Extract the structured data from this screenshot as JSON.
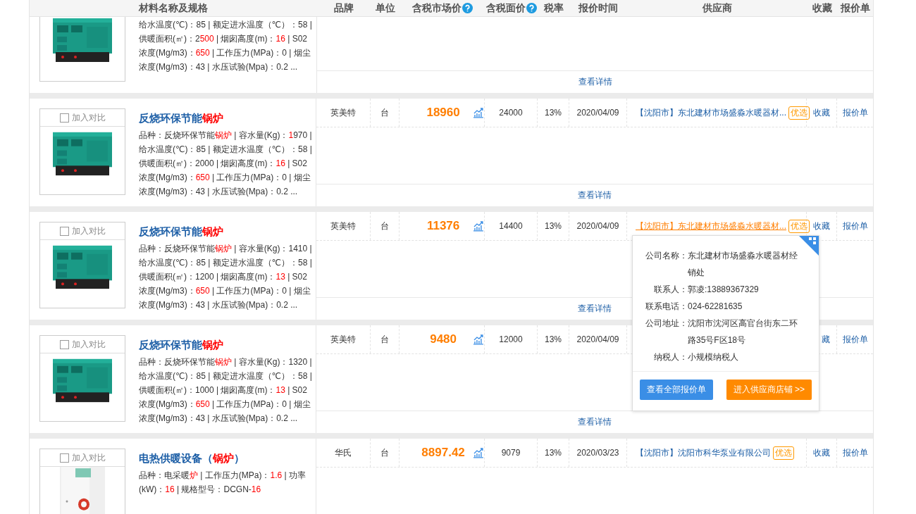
{
  "header": {
    "columns": [
      {
        "label": "材料名称及规格"
      },
      {
        "label": "品牌"
      },
      {
        "label": "单位"
      },
      {
        "label": "含税市场价",
        "help": true
      },
      {
        "label": "含税面价",
        "help": true
      },
      {
        "label": "税率"
      },
      {
        "label": "报价时间"
      },
      {
        "label": "供应商"
      },
      {
        "label": "收藏"
      },
      {
        "label": "报价单"
      }
    ]
  },
  "rows": [
    {
      "spec": [
        {
          "text": "给水温度(℃)：85 | 额定进水温度（℃）：58 | 供暖面积(㎡)：2",
          "highlight": false
        },
        {
          "text": "500",
          "highlight": true
        },
        {
          "text": " | 烟囱高度(m)：",
          "highlight": false
        },
        {
          "text": "16",
          "highlight": true
        },
        {
          "text": " | S02浓度(Mg/m3)：",
          "highlight": false
        },
        {
          "text": "650",
          "highlight": true
        },
        {
          "text": " | 工作压力(MPa)：0 | 烟尘浓度(Mg/m3)：43 | 水压试验(Mpa)：0.2 ...",
          "highlight": false
        }
      ],
      "details": "查看详情"
    },
    {
      "compare": {
        "label": "加入对比",
        "checked": false
      },
      "title": [
        {
          "text": "反烧环保节能",
          "highlight": false
        },
        {
          "text": "锅炉",
          "highlight": true
        }
      ],
      "spec": [
        {
          "text": "品种：反烧环保节能",
          "highlight": false
        },
        {
          "text": "锅炉",
          "highlight": true
        },
        {
          "text": " | 容水量(Kg)：",
          "highlight": false
        },
        {
          "text": "1",
          "highlight": true
        },
        {
          "text": "970 | 给水温度(℃)：85 | 额定进水温度（℃）：58 | 供暖面积(㎡)：2000 | 烟囱高度(m)：",
          "highlight": false
        },
        {
          "text": "16",
          "highlight": true
        },
        {
          "text": " | S02浓度(Mg/m3)：",
          "highlight": false
        },
        {
          "text": "650",
          "highlight": true
        },
        {
          "text": " | 工作压力(MPa)：0 | 烟尘浓度(Mg/m3)：43 | 水压试验(Mpa)：0.2 ...",
          "highlight": false
        }
      ],
      "cells": {
        "brand": "英美特",
        "unit": "台",
        "price": "18960",
        "face_price": "24000",
        "tax": "13%",
        "date": "2020/04/09",
        "supplier": {
          "text": "【沈阳市】东北建材市场盛淼水暖器材...",
          "hovered": false
        },
        "badge": "优选",
        "collect": "收藏",
        "quote": "报价单"
      },
      "details": "查看详情"
    },
    {
      "compare": {
        "label": "加入对比",
        "checked": false
      },
      "title": [
        {
          "text": "反烧环保节能",
          "highlight": false
        },
        {
          "text": "锅炉",
          "highlight": true
        }
      ],
      "spec": [
        {
          "text": "品种：反烧环保节能",
          "highlight": false
        },
        {
          "text": "锅炉",
          "highlight": true
        },
        {
          "text": " | 容水量(Kg)：1410 | 给水温度(℃)：85 | 额定进水温度（℃）：58 | 供暖面积(㎡)：1200 | 烟囱高度(m)：",
          "highlight": false
        },
        {
          "text": "13",
          "highlight": true
        },
        {
          "text": " | S02浓度(Mg/m3)：",
          "highlight": false
        },
        {
          "text": "650",
          "highlight": true
        },
        {
          "text": " | 工作压力(MPa)：0 | 烟尘浓度(Mg/m3)：43 | 水压试验(Mpa)：0.2 ...",
          "highlight": false
        }
      ],
      "cells": {
        "brand": "英美特",
        "unit": "台",
        "price": "11376",
        "face_price": "14400",
        "tax": "13%",
        "date": "2020/04/09",
        "supplier": {
          "text": "【沈阳市】东北建材市场盛淼水暖器材...",
          "hovered": true
        },
        "badge": "优选",
        "collect": "收藏",
        "quote": "报价单"
      },
      "details": "查看详情"
    },
    {
      "compare": {
        "label": "加入对比",
        "checked": false
      },
      "title": [
        {
          "text": "反烧环保节能",
          "highlight": false
        },
        {
          "text": "锅炉",
          "highlight": true
        }
      ],
      "spec": [
        {
          "text": "品种：反烧环保节能",
          "highlight": false
        },
        {
          "text": "锅炉",
          "highlight": true
        },
        {
          "text": " | 容水量(Kg)：1320 | 给水温度(℃)：85 | 额定进水温度（℃）：58 | 供暖面积(㎡)：1000 | 烟囱高度(m)：",
          "highlight": false
        },
        {
          "text": "13",
          "highlight": true
        },
        {
          "text": " | S02浓度(Mg/m3)：",
          "highlight": false
        },
        {
          "text": "650",
          "highlight": true
        },
        {
          "text": " | 工作压力(MPa)：0 | 烟尘浓度(Mg/m3)：43 | 水压试验(Mpa)：0.2 ...",
          "highlight": false
        }
      ],
      "cells": {
        "brand": "英美特",
        "unit": "台",
        "price": "9480",
        "face_price": "12000",
        "tax": "13%",
        "date": "2020/04/09",
        "collect": "藏",
        "quote": "报价单"
      },
      "details": "查看详情"
    },
    {
      "compare": {
        "label": "加入对比",
        "checked": false
      },
      "title": [
        {
          "text": "电热供暖设备（",
          "highlight": false
        },
        {
          "text": "锅炉",
          "highlight": true
        },
        {
          "text": "）",
          "highlight": false
        }
      ],
      "spec": [
        {
          "text": "品种：电采暖",
          "highlight": false
        },
        {
          "text": "炉",
          "highlight": true
        },
        {
          "text": " | 工作压力(MPa)：",
          "highlight": false
        },
        {
          "text": "1.6",
          "highlight": true
        },
        {
          "text": " | 功率(kW)：",
          "highlight": false
        },
        {
          "text": "16",
          "highlight": true
        },
        {
          "text": " | 规格型号：DCGN-",
          "highlight": false
        },
        {
          "text": "16",
          "highlight": true
        }
      ],
      "cells": {
        "brand": "华氏",
        "unit": "台",
        "price": "8897.42",
        "face_price": "9079",
        "tax": "13%",
        "date": "2020/03/23",
        "supplier": {
          "text": "【沈阳市】沈阳市科华泵业有限公司",
          "hovered": false
        },
        "badge": "优选",
        "collect": "收藏",
        "quote": "报价单"
      }
    }
  ],
  "popup": {
    "fields": [
      {
        "label": "公司名称：",
        "value": "东北建材市场盛淼水暖器材经销处"
      },
      {
        "label": "联系人：",
        "value": "郭凌:13889367329"
      },
      {
        "label": "联系电话：",
        "value": "024-62281635"
      },
      {
        "label": "公司地址：",
        "value": "沈阳市沈河区高官台街东二环路35号F区18号"
      },
      {
        "label": "纳税人：",
        "value": "小规模纳税人"
      }
    ],
    "buttons": [
      {
        "label": "查看全部报价单",
        "kind": "primary"
      },
      {
        "label": "进入供应商店铺 >>",
        "kind": "accent"
      }
    ]
  }
}
